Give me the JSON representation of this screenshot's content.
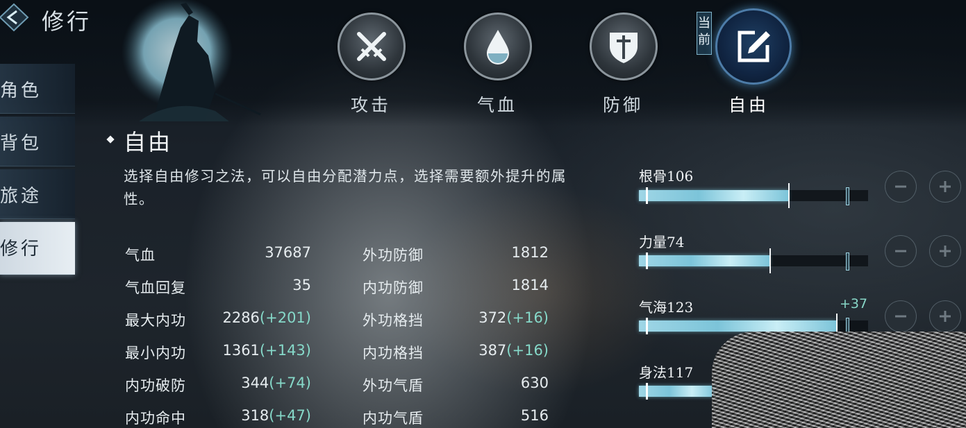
{
  "header": {
    "title": "修行"
  },
  "sidebar": {
    "items": [
      {
        "label": "角色"
      },
      {
        "label": "背包"
      },
      {
        "label": "旅途"
      },
      {
        "label": "修行"
      }
    ]
  },
  "tabs": [
    {
      "label": "攻击",
      "icon": "crossed-swords-icon"
    },
    {
      "label": "气血",
      "icon": "droplet-icon"
    },
    {
      "label": "防御",
      "icon": "shield-icon"
    },
    {
      "label": "自由",
      "icon": "edit-icon"
    }
  ],
  "current_tag": "当前",
  "section": {
    "title": "自由",
    "description": "选择自由修习之法，可以自由分配潜力点，选择需要额外提升的属性。"
  },
  "stats_left": [
    {
      "label": "气血",
      "value": "37687",
      "bonus": ""
    },
    {
      "label": "气血回复",
      "value": "35",
      "bonus": ""
    },
    {
      "label": "最大内功",
      "value": "2286",
      "bonus": "(+201)"
    },
    {
      "label": "最小内功",
      "value": "1361",
      "bonus": "(+143)"
    },
    {
      "label": "内功破防",
      "value": "344",
      "bonus": "(+74)"
    },
    {
      "label": "内功命中",
      "value": "318",
      "bonus": "(+47)"
    }
  ],
  "stats_right": [
    {
      "label": "外功防御",
      "value": "1812",
      "bonus": ""
    },
    {
      "label": "内功防御",
      "value": "1814",
      "bonus": ""
    },
    {
      "label": "外功格挡",
      "value": "372",
      "bonus": "(+16)"
    },
    {
      "label": "内功格挡",
      "value": "387",
      "bonus": "(+16)"
    },
    {
      "label": "外功气盾",
      "value": "630",
      "bonus": ""
    },
    {
      "label": "内功气盾",
      "value": "516",
      "bonus": ""
    }
  ],
  "attributes": [
    {
      "label": "根骨106",
      "fill": 0.65,
      "added": ""
    },
    {
      "label": "力量74",
      "fill": 0.57,
      "added": ""
    },
    {
      "label": "气海123",
      "fill": 0.86,
      "added": "+37"
    },
    {
      "label": "身法117",
      "fill": 0.33,
      "added": ""
    }
  ],
  "colors": {
    "bar": "#7cc4d9",
    "bonus": "#86d9c9",
    "active_tab": "#4d7ca8"
  }
}
